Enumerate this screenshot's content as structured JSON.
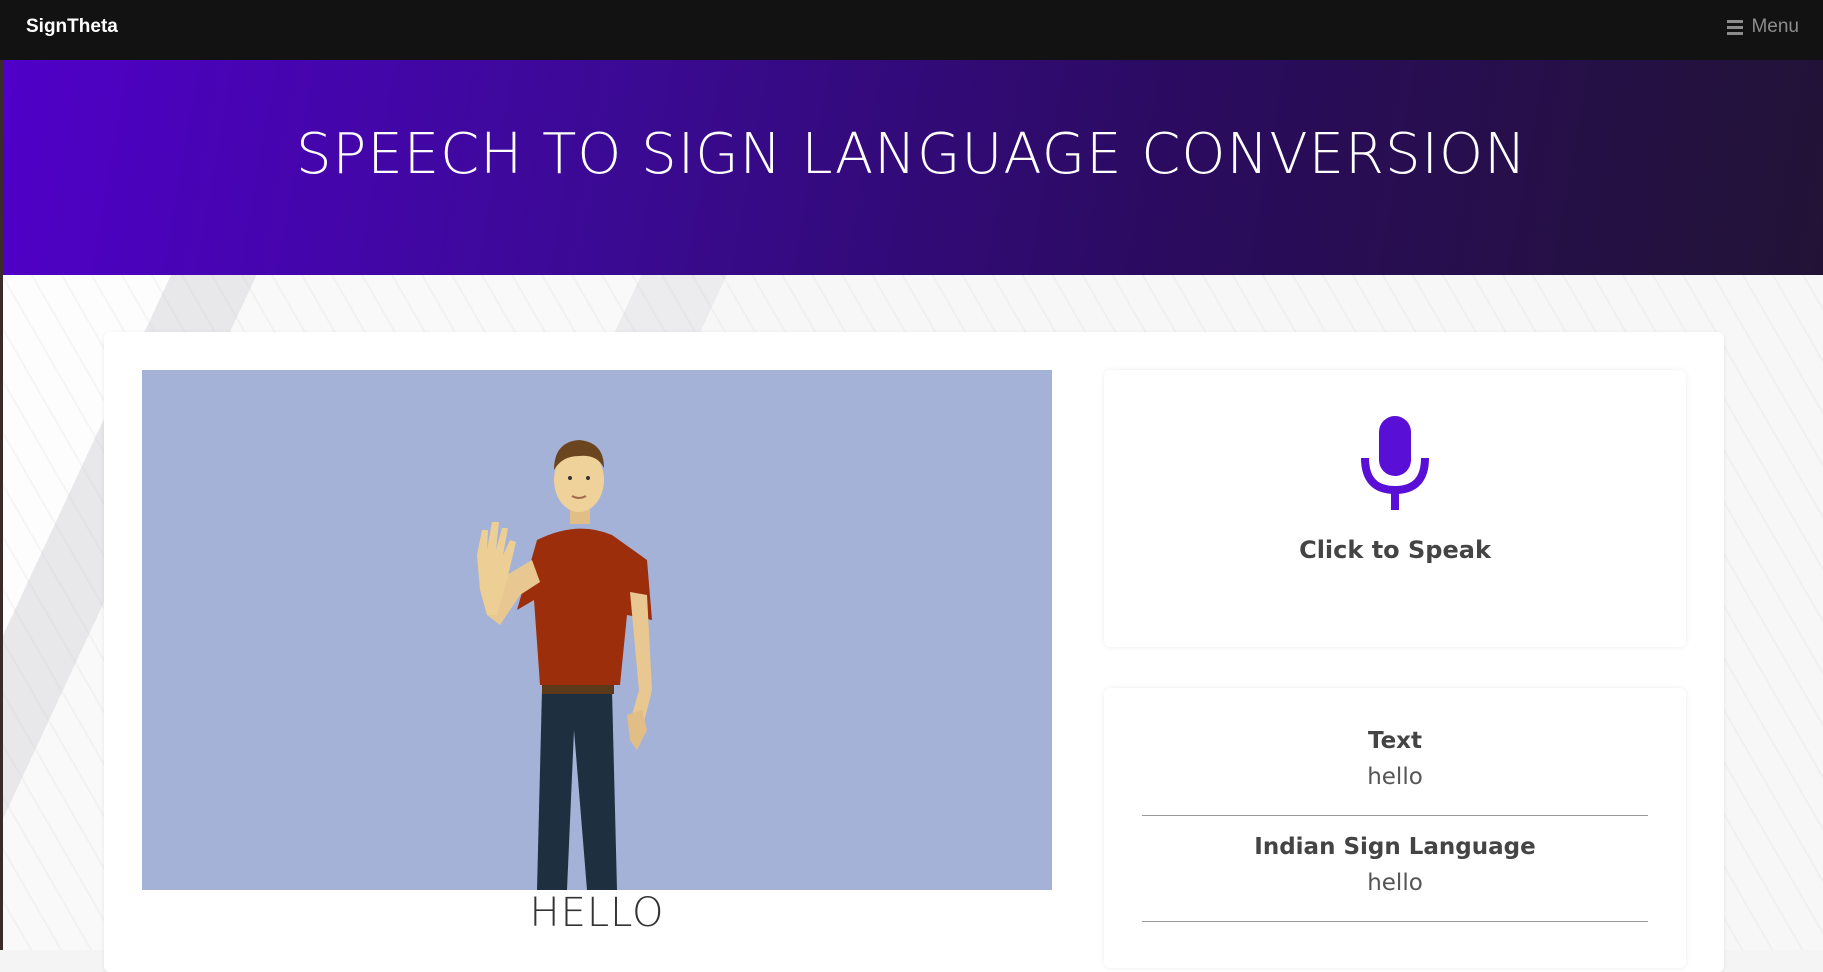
{
  "topbar": {
    "brand": "SignTheta",
    "menu_label": "Menu"
  },
  "header": {
    "title": "SPEECH TO SIGN LANGUAGE CONVERSION"
  },
  "stage": {
    "caption": "HELLO",
    "background_color": "#a5b2d7"
  },
  "speak": {
    "label": "Click to Speak",
    "icon": "microphone-icon",
    "icon_color": "#5a0fd6"
  },
  "info": {
    "text_title": "Text",
    "text_value": "hello",
    "isl_title": "Indian Sign Language",
    "isl_value": "hello"
  },
  "colors": {
    "header_start": "#5000c8",
    "header_end": "#221336",
    "topbar": "#121212"
  }
}
